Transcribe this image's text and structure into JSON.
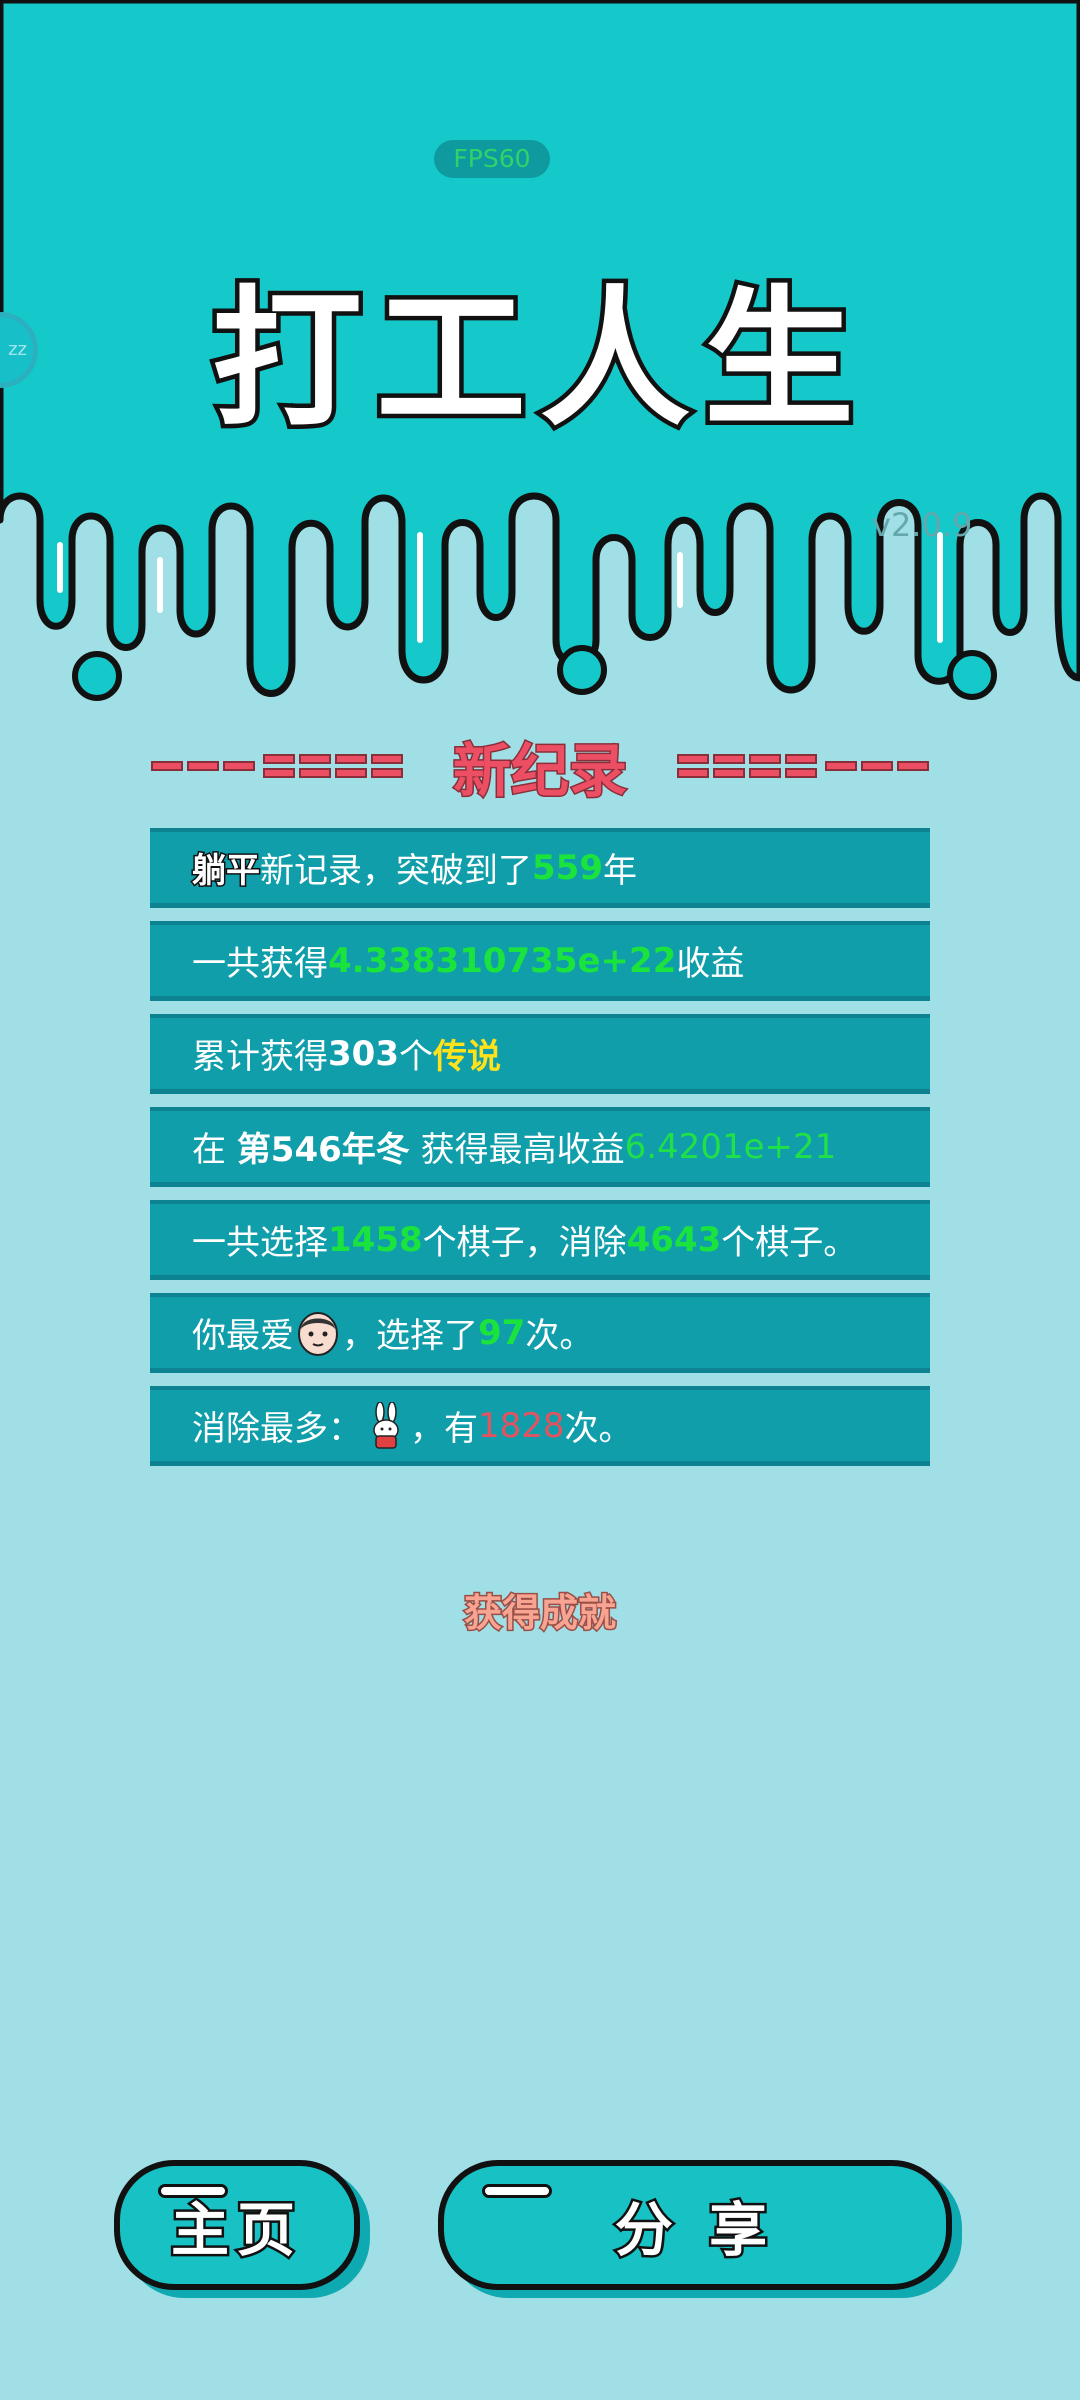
{
  "fps": "FPS60",
  "title": "打工人生",
  "version": "v2.0.9",
  "record_title": "新纪录",
  "stats": {
    "row1": {
      "name": "躺平",
      "t1": "新记录，突破到了",
      "years": "559",
      "t2": "年"
    },
    "row2": {
      "t1": "一共获得",
      "income": "4.338310735e+22",
      "t2": "收益"
    },
    "row3": {
      "t1": "累计获得",
      "count": "303",
      "t2": "个",
      "rarity": "传说"
    },
    "row4": {
      "t1": "在 ",
      "period": "第546年冬",
      "t2": " 获得最高收益",
      "income": "6.4201e+21"
    },
    "row5": {
      "t1": "一共选择",
      "selected": "1458",
      "t2": "个棋子，消除",
      "eliminated": "4643",
      "t3": "个棋子。"
    },
    "row6": {
      "t1": "你最爱",
      "t2": "，选择了",
      "times": "97",
      "t3": "次。"
    },
    "row7": {
      "t1": "消除最多：",
      "t2": "，有",
      "times": "1828",
      "t3": "次。"
    }
  },
  "achievement": "获得成就",
  "buttons": {
    "home": "主页",
    "share": "分 享"
  },
  "colors": {
    "top_bg": "#15c8c9",
    "bottom_bg": "#a0dfe5",
    "row_bg": "#119eab",
    "highlight_green": "#1be33e",
    "highlight_yellow": "#ffe21a",
    "highlight_red": "#e3535f"
  },
  "icons": {
    "sleep": "sleep-zzz-icon",
    "favorite_piece": "face-avatar-icon",
    "most_eliminated_piece": "rabbit-icon"
  }
}
